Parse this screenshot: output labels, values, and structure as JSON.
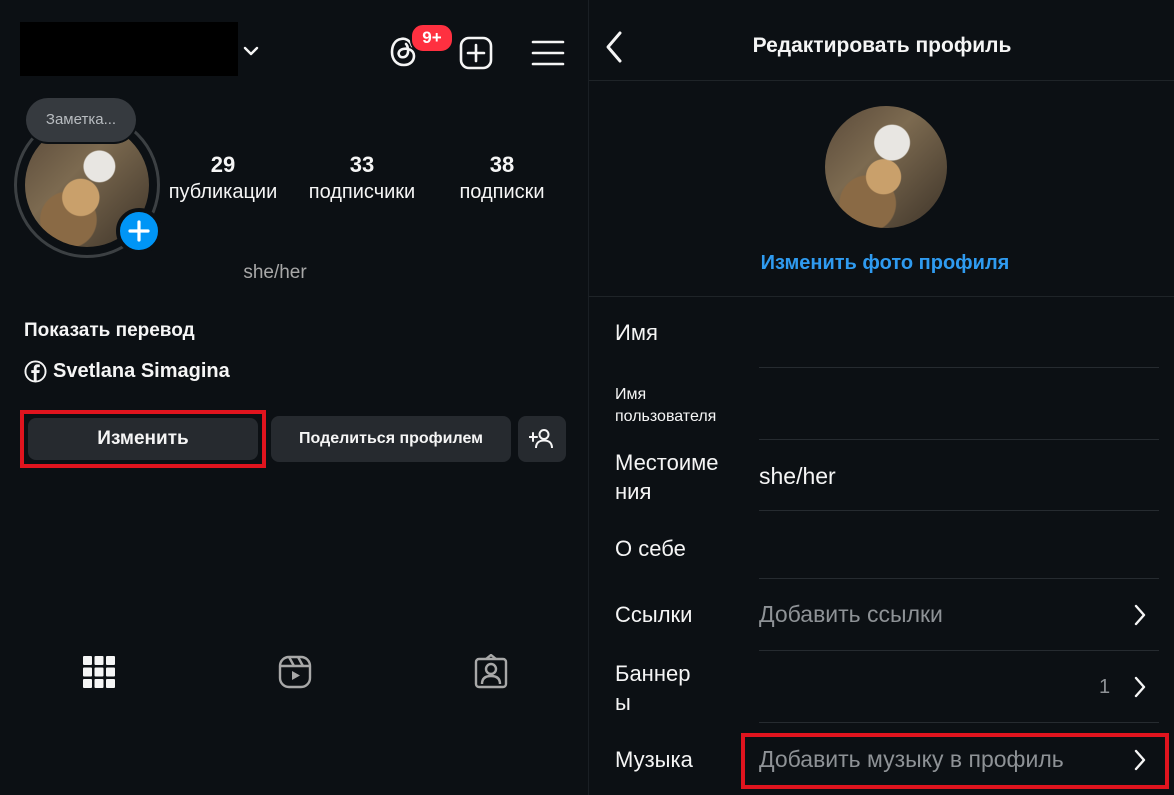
{
  "left": {
    "threads_badge": "9+",
    "note": "Заметка...",
    "stats": [
      {
        "num": "29",
        "label": "публикации"
      },
      {
        "num": "33",
        "label": "подписчики"
      },
      {
        "num": "38",
        "label": "подписки"
      }
    ],
    "pronouns": "she/her",
    "show_translation": "Показать перевод",
    "facebook_name": "Svetlana Simagina",
    "edit_label": "Изменить",
    "share_label": "Поделиться профилем",
    "tabs": [
      "grid-icon",
      "reels-icon",
      "tagged-icon"
    ]
  },
  "right": {
    "title": "Редактировать профиль",
    "change_photo": "Изменить фото профиля",
    "fields": {
      "name": "Имя",
      "username_l1": "Имя",
      "username_l2": "пользователя",
      "pronouns_l1": "Местоиме",
      "pronouns_l2": "ния",
      "pronouns_value": "she/her",
      "bio": "О себе",
      "links": "Ссылки",
      "links_value": "Добавить ссылки",
      "banners_l1": "Баннер",
      "banners_l2": "ы",
      "banners_count": "1",
      "music": "Музыка",
      "music_value": "Добавить музыку в профиль"
    }
  },
  "colors": {
    "background": "#0c1014",
    "accent_blue": "#0095f6",
    "link_blue": "#2f9bf0",
    "highlight_red": "#e0141e",
    "badge_red": "#ff3040",
    "button_bg": "#262a2f"
  }
}
